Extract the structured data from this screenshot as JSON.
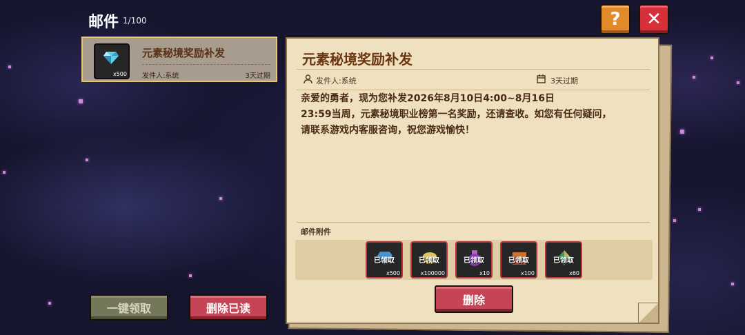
{
  "header": {
    "title": "邮件",
    "count": "1/100",
    "help_label": "?",
    "close_label": "✕"
  },
  "mail_list": [
    {
      "subject": "元素秘境奖励补发",
      "sender": "发件人:系统",
      "expire": "3天过期",
      "icon": "diamond-icon",
      "qty": "x500"
    }
  ],
  "detail": {
    "subject": "元素秘境奖励补发",
    "sender": "发件人:系统",
    "expire": "3天过期",
    "body": "亲爱的勇者，现为您补发2026年8月10日4:00~8月16日\n23:59当周，元素秘境职业榜第一名奖励，还请查收。如您有任何疑问，\n请联系游戏内客服咨询，祝您游戏愉快！",
    "attachments_label": "邮件附件",
    "attachments": [
      {
        "status": "已领取",
        "qty": "x500",
        "icon": "diamond-icon"
      },
      {
        "status": "已领取",
        "qty": "x100000",
        "icon": "gold-icon"
      },
      {
        "status": "已领取",
        "qty": "x10",
        "icon": "potion-icon"
      },
      {
        "status": "已领取",
        "qty": "x100",
        "icon": "chest-icon"
      },
      {
        "status": "已领取",
        "qty": "x60",
        "icon": "crystal-icon"
      }
    ],
    "delete_label": "删除"
  },
  "actions": {
    "claim_all": "一键领取",
    "delete_read": "删除已读"
  },
  "colors": {
    "accent_red": "#c54456",
    "selected_border": "#e8c56a",
    "paper": "#efe1c0"
  }
}
